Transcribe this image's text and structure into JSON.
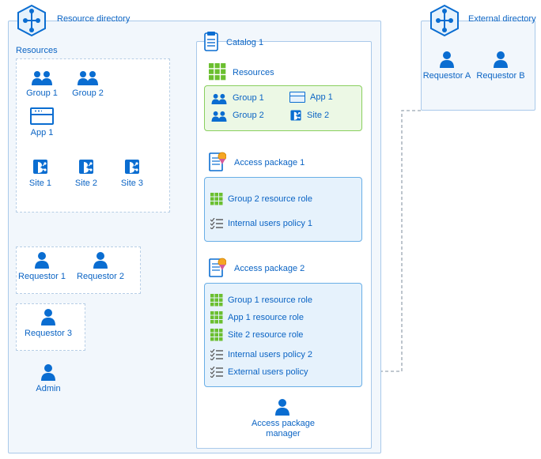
{
  "resourceDirectory": {
    "title": "Resource directory",
    "resourcesLabel": "Resources",
    "groups": [
      "Group 1",
      "Group 2"
    ],
    "apps": [
      "App 1"
    ],
    "sites": [
      "Site 1",
      "Site 2",
      "Site 3"
    ],
    "requestors": [
      "Requestor 1",
      "Requestor 2",
      "Requestor 3"
    ],
    "admin": "Admin"
  },
  "catalog": {
    "title": "Catalog 1",
    "resources": {
      "label": "Resources",
      "items": {
        "group1": "Group 1",
        "group2": "Group 2",
        "app1": "App 1",
        "site2": "Site 2"
      }
    },
    "accessPackages": [
      {
        "title": "Access package 1",
        "roles": [
          "Group 2 resource role"
        ],
        "policies": [
          "Internal users policy 1"
        ]
      },
      {
        "title": "Access package 2",
        "roles": [
          "Group 1 resource role",
          "App 1 resource role",
          "Site 2 resource role"
        ],
        "policies": [
          "Internal users policy 2",
          "External users policy"
        ]
      }
    ],
    "manager": "Access package\nmanager"
  },
  "externalDirectory": {
    "title": "External directory",
    "requestors": [
      "Requestor A",
      "Requestor B"
    ]
  }
}
